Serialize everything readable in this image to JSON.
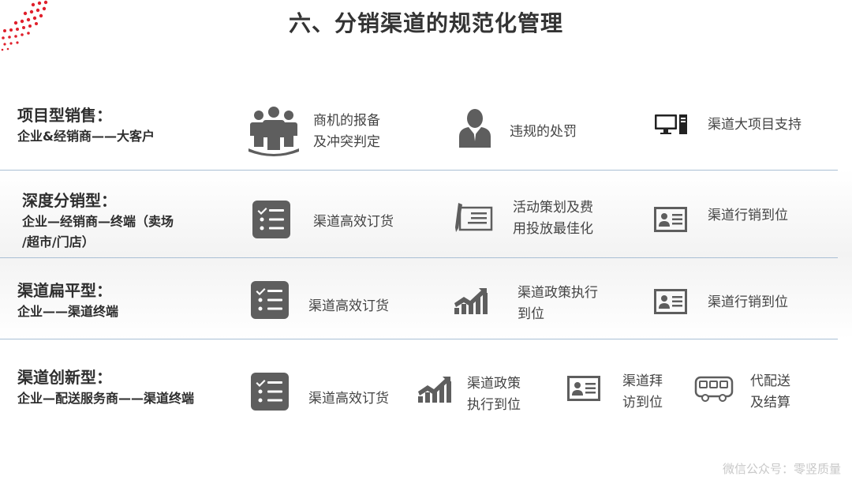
{
  "title": "六、分销渠道的规范化管理",
  "colors": {
    "accent": "#e0202c",
    "icon": "#5e5e5e",
    "divider": "#a9bfd4"
  },
  "rows": [
    {
      "title": "项目型销售：",
      "subtitle": [
        "企业&经销商——大客户"
      ],
      "items": [
        {
          "icon": "people-group-icon",
          "text": [
            "商机的报备",
            "及冲突判定"
          ]
        },
        {
          "icon": "person-icon",
          "text": [
            "违规的处罚"
          ]
        },
        {
          "icon": "computer-icon",
          "text": [
            "渠道大项目支持"
          ]
        }
      ]
    },
    {
      "title": "深度分销型：",
      "subtitle": [
        "企业—经销商—终端（卖场",
        "/超市/门店）"
      ],
      "items": [
        {
          "icon": "checklist-icon",
          "text": [
            "渠道高效订货"
          ]
        },
        {
          "icon": "contract-pen-icon",
          "text": [
            "活动策划及费",
            "用投放最佳化"
          ]
        },
        {
          "icon": "id-card-icon",
          "text": [
            "渠道行销到位"
          ]
        }
      ]
    },
    {
      "title": "渠道扁平型：",
      "subtitle": [
        "企业——渠道终端"
      ],
      "items": [
        {
          "icon": "checklist-icon",
          "text": [
            "渠道高效订货"
          ]
        },
        {
          "icon": "growth-chart-icon",
          "text": [
            "渠道政策执行",
            "到位"
          ]
        },
        {
          "icon": "id-card-icon",
          "text": [
            "渠道行销到位"
          ]
        }
      ]
    },
    {
      "title": "渠道创新型：",
      "subtitle": [
        "企业—配送服务商——渠道终端"
      ],
      "items": [
        {
          "icon": "checklist-icon",
          "text": [
            "渠道高效订货"
          ]
        },
        {
          "icon": "growth-chart-icon",
          "text": [
            "渠道政策",
            "执行到位"
          ]
        },
        {
          "icon": "id-card-icon",
          "text": [
            "渠道拜",
            "访到位"
          ]
        },
        {
          "icon": "bus-icon",
          "text": [
            "代配送",
            "及结算"
          ]
        }
      ]
    }
  ],
  "watermark": "微信公众号：零竖质量"
}
